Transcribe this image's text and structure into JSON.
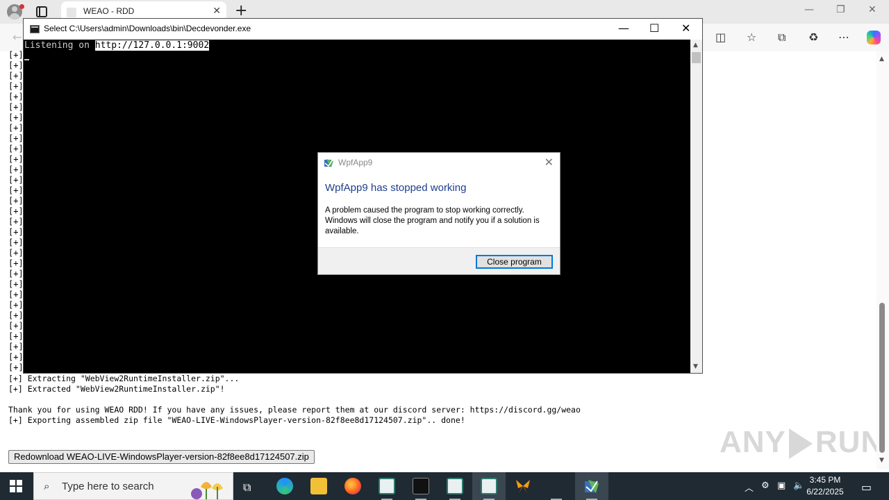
{
  "browser": {
    "tab_title": "WEAO - RDD"
  },
  "page": {
    "lines": [
      "[+] Extracting \"WebView2RuntimeInstaller.zip\"...",
      "[+] Extracted \"WebView2RuntimeInstaller.zip\"!",
      "Thank you for using WEAO RDD! If you have any issues, please report them at our discord server: https://discord.gg/weao",
      "[+] Exporting assembled zip file \"WEAO-LIVE-WindowsPlayer-version-82f8ee8d17124507.zip\".. done!"
    ],
    "plus_marker": "[+]",
    "redownload_label": "Redownload WEAO-LIVE-WindowsPlayer-version-82f8ee8d17124507.zip",
    "watermark": "ANY RUN"
  },
  "console": {
    "title": "Select C:\\Users\\admin\\Downloads\\bin\\Decdevonder.exe",
    "prefix": "Listening on ",
    "url": "http://127.0.0.1:9002"
  },
  "dialog": {
    "title": "WpfApp9",
    "heading": "WpfApp9 has stopped working",
    "message": "A problem caused the program to stop working correctly. Windows will close the program and notify you if a solution is available.",
    "button": "Close program"
  },
  "taskbar": {
    "search_placeholder": "Type here to search",
    "time": "3:45 PM",
    "date": "6/22/2025"
  },
  "colors": {
    "taskbar": "#1f2a33",
    "dialog_heading": "#1e3d8c",
    "button_focus": "#0078d7"
  }
}
